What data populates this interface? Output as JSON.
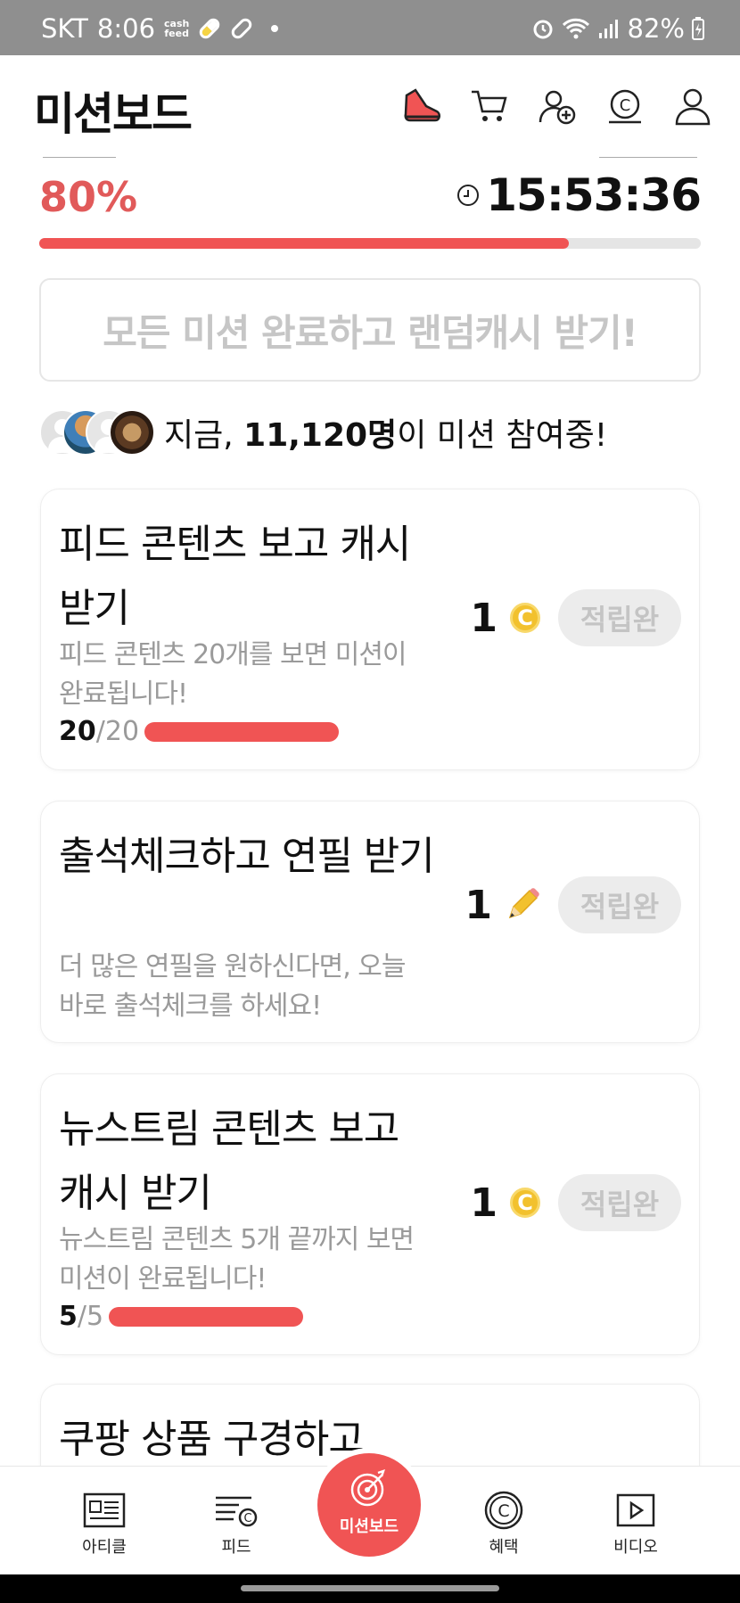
{
  "status_bar": {
    "carrier": "SKT",
    "time": "8:06",
    "cashfeed_label_top": "cash",
    "cashfeed_label_bottom": "feed",
    "battery": "82%"
  },
  "header": {
    "title": "미션보드",
    "icons": [
      "sneaker-icon",
      "cart-icon",
      "add-friend-icon",
      "cash-coin-icon",
      "profile-icon"
    ]
  },
  "progress": {
    "percent_label": "80%",
    "fraction": 0.8,
    "timer": "15:53:36"
  },
  "random_cash_button": "모든 미션 완료하고 랜덤캐시 받기!",
  "participants": {
    "prefix": "지금, ",
    "count": "11,120명",
    "suffix": "이 미션 참여중!"
  },
  "missions": [
    {
      "title": "피드 콘텐츠 보고 캐시 받기",
      "desc": "피드 콘텐츠 20개를 보면 미션이 완료됩니다!",
      "reward": "1",
      "reward_icon": "coin-icon",
      "button": "적립완",
      "progress_done": "20",
      "progress_total": "/20",
      "progress_fraction": 1.0
    },
    {
      "title": "출석체크하고 연필 받기",
      "desc": "더 많은 연필을 원하신다면, 오늘 바로 출석체크를 하세요!",
      "reward": "1",
      "reward_icon": "pencil-icon",
      "button": "적립완"
    },
    {
      "title": "뉴스트림 콘텐츠 보고 캐시 받기",
      "desc": "뉴스트림 콘텐츠 5개 끝까지 보면 미션이 완료됩니다!",
      "reward": "1",
      "reward_icon": "coin-icon",
      "button": "적립완",
      "progress_done": "5",
      "progress_total": "/5",
      "progress_fraction": 1.0
    },
    {
      "title": "쿠팡 상품 구경하고"
    }
  ],
  "coin_glyph": "C",
  "bottom_nav": [
    {
      "label": "아티클",
      "icon": "article-icon"
    },
    {
      "label": "피드",
      "icon": "feed-icon"
    },
    {
      "label": "미션보드",
      "icon": "target-icon"
    },
    {
      "label": "혜택",
      "icon": "benefit-icon"
    },
    {
      "label": "비디오",
      "icon": "video-icon"
    }
  ],
  "colors": {
    "accent": "#f05454",
    "percent_text": "#e15a5a",
    "coin": "#f2c12e",
    "muted": "#9a9a9a"
  }
}
